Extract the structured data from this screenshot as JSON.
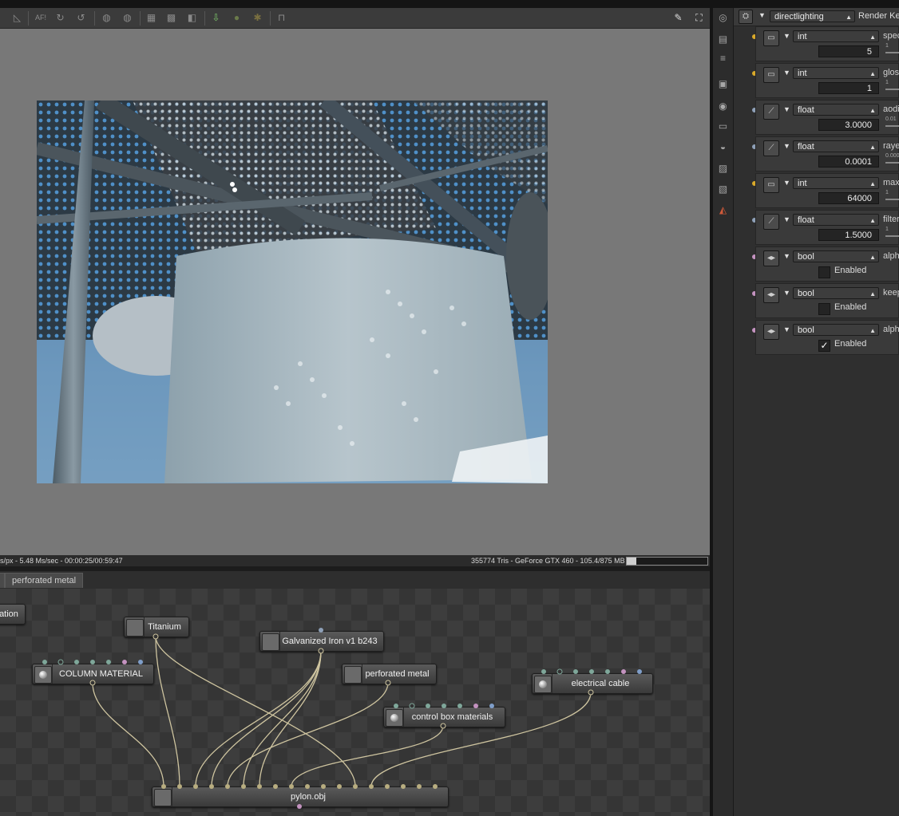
{
  "toolbar": {
    "af_label": "AF!",
    "icons": [
      "ruler-icon",
      "autofocus-icon",
      "pick-focus-icon",
      "pick-white-balance-icon",
      "material-picker-icon",
      "object-picker-icon",
      "region-icon",
      "film-region-icon",
      "lock-icon",
      "export-icon",
      "locate-icon",
      "star-icon",
      "padlock-icon",
      "wrench-icon",
      "fullscreen-icon"
    ]
  },
  "status": {
    "left": "s/px - 5.48 Ms/sec - 00:00:25/00:59:47",
    "right": "355774 Tris - GeForce GTX 460 - 105.4/875 MB",
    "progress": 0.12
  },
  "tabs": [
    "perforated metal"
  ],
  "node_graph": {
    "nodes": [
      {
        "label": "ation",
        "type": "group"
      },
      {
        "label": "Titanium",
        "type": "material"
      },
      {
        "label": "Galvanized Iron v1 b243",
        "type": "material"
      },
      {
        "label": "COLUMN MATERIAL",
        "type": "material"
      },
      {
        "label": "perforated metal",
        "type": "material"
      },
      {
        "label": "electrical cable",
        "type": "material"
      },
      {
        "label": "control box materials",
        "type": "material"
      },
      {
        "label": "pylon.obj",
        "type": "mesh"
      }
    ]
  },
  "right_panel": {
    "kernel_select": "directlighting",
    "kernel_label": "Render Ker",
    "params": [
      {
        "type": "int",
        "name": "spec",
        "value": "5",
        "pin": "#d9a92a",
        "slider_min": "1"
      },
      {
        "type": "int",
        "name": "glos",
        "value": "1",
        "pin": "#d9a92a",
        "slider_min": "1"
      },
      {
        "type": "float",
        "name": "aodi",
        "value": "3.0000",
        "pin": "#8ea0b8",
        "slider_min": "0.01"
      },
      {
        "type": "float",
        "name": "raye",
        "value": "0.0001",
        "pin": "#8ea0b8",
        "slider_min": "0.000"
      },
      {
        "type": "int",
        "name": "max",
        "value": "64000",
        "pin": "#d9a92a",
        "slider_min": "1"
      },
      {
        "type": "float",
        "name": "filter",
        "value": "1.5000",
        "pin": "#8ea0b8",
        "slider_min": "1"
      },
      {
        "type": "bool",
        "name": "alph",
        "value": "Enabled",
        "checked": false,
        "pin": "#c493c0"
      },
      {
        "type": "bool",
        "name": "keep",
        "value": "Enabled",
        "checked": false,
        "pin": "#c493c0"
      },
      {
        "type": "bool",
        "name": "alph",
        "value": "Enabled",
        "checked": true,
        "pin": "#c493c0"
      }
    ]
  }
}
